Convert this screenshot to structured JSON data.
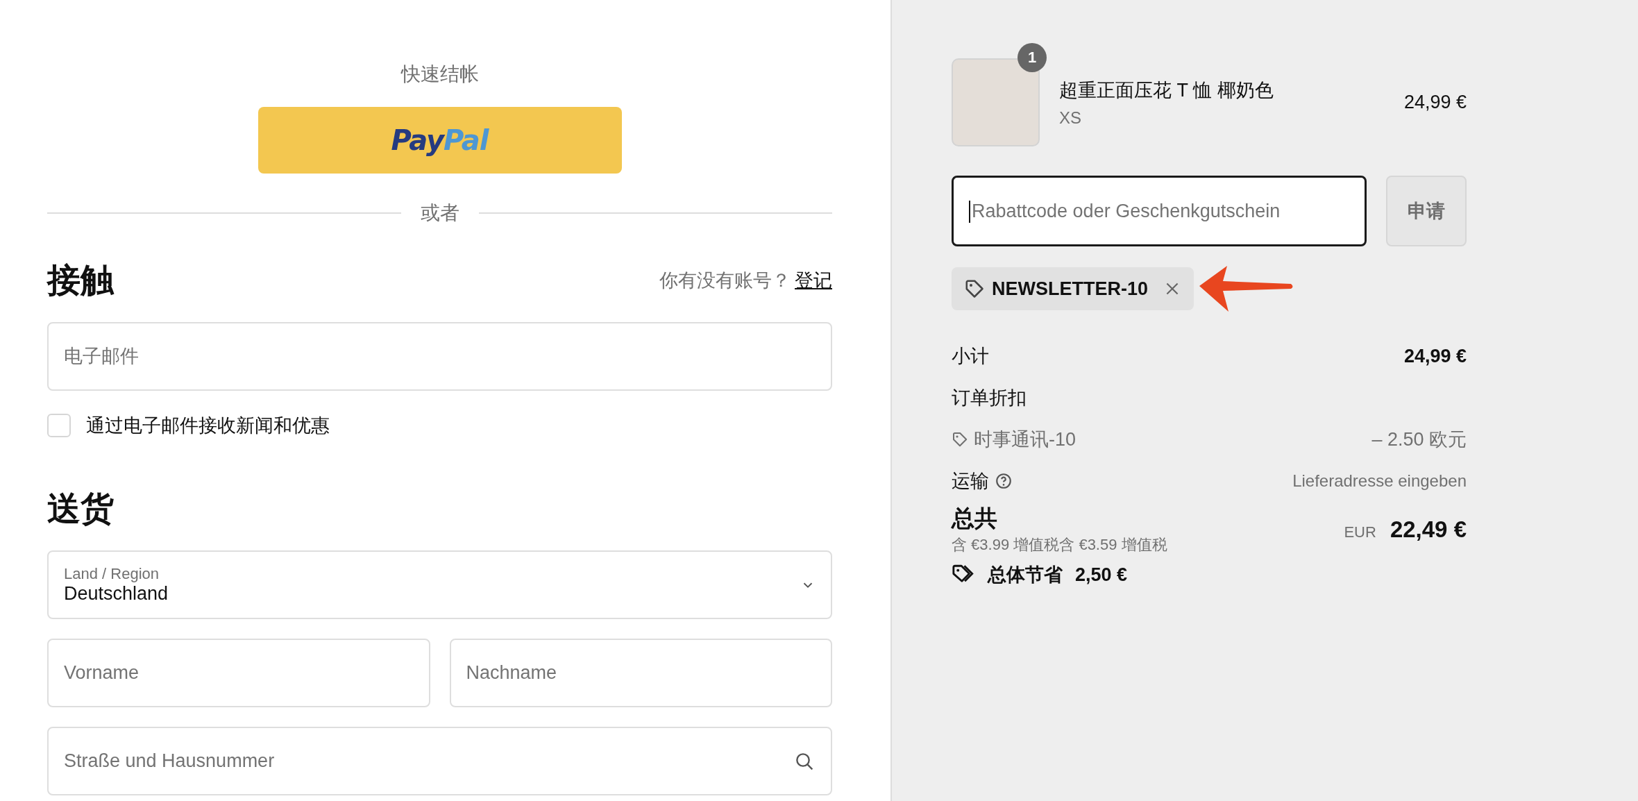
{
  "express_checkout": {
    "title": "快速结帐",
    "paypal_logo": [
      "Pay",
      "Pal"
    ]
  },
  "divider_text": "或者",
  "contact": {
    "heading": "接触",
    "account_prompt": "你有没有账号？",
    "login_link": "登记",
    "email": {
      "placeholder": "电子邮件"
    },
    "newsletter": {
      "label": "通过电子邮件接收新闻和优惠",
      "checked": false
    }
  },
  "delivery": {
    "heading": "送货",
    "country": {
      "label": "Land / Region",
      "value": "Deutschland"
    },
    "first_name": {
      "placeholder": "Vorname"
    },
    "last_name": {
      "placeholder": "Nachname"
    },
    "street": {
      "placeholder": "Straße und Hausnummer"
    }
  },
  "cart": {
    "items": [
      {
        "name": "超重正面压花 T 恤 椰奶色",
        "variant": "XS",
        "quantity": "1",
        "price": "24,99 €"
      }
    ],
    "discount": {
      "placeholder": "Rabattcode oder Geschenkgutschein",
      "focused": true,
      "apply_label": "申请",
      "apply_disabled": true
    },
    "applied_codes": [
      {
        "code": "NEWSLETTER-10"
      }
    ],
    "summary": {
      "subtotal": {
        "label": "小计",
        "value": "24,99 €"
      },
      "order_discount": {
        "label": "订单折扣"
      },
      "discount_lines": [
        {
          "code": "时事通讯-10",
          "amount": "– 2.50 欧元"
        }
      ],
      "shipping": {
        "label": "运输",
        "value": "Lieferadresse eingeben"
      },
      "total": {
        "label": "总共",
        "tax_note": "含 €3.99 增值税含 €3.59 增值税",
        "currency": "EUR",
        "value": "22,49 €"
      },
      "savings": {
        "label": "总体节省",
        "value": "2,50 €"
      }
    }
  }
}
